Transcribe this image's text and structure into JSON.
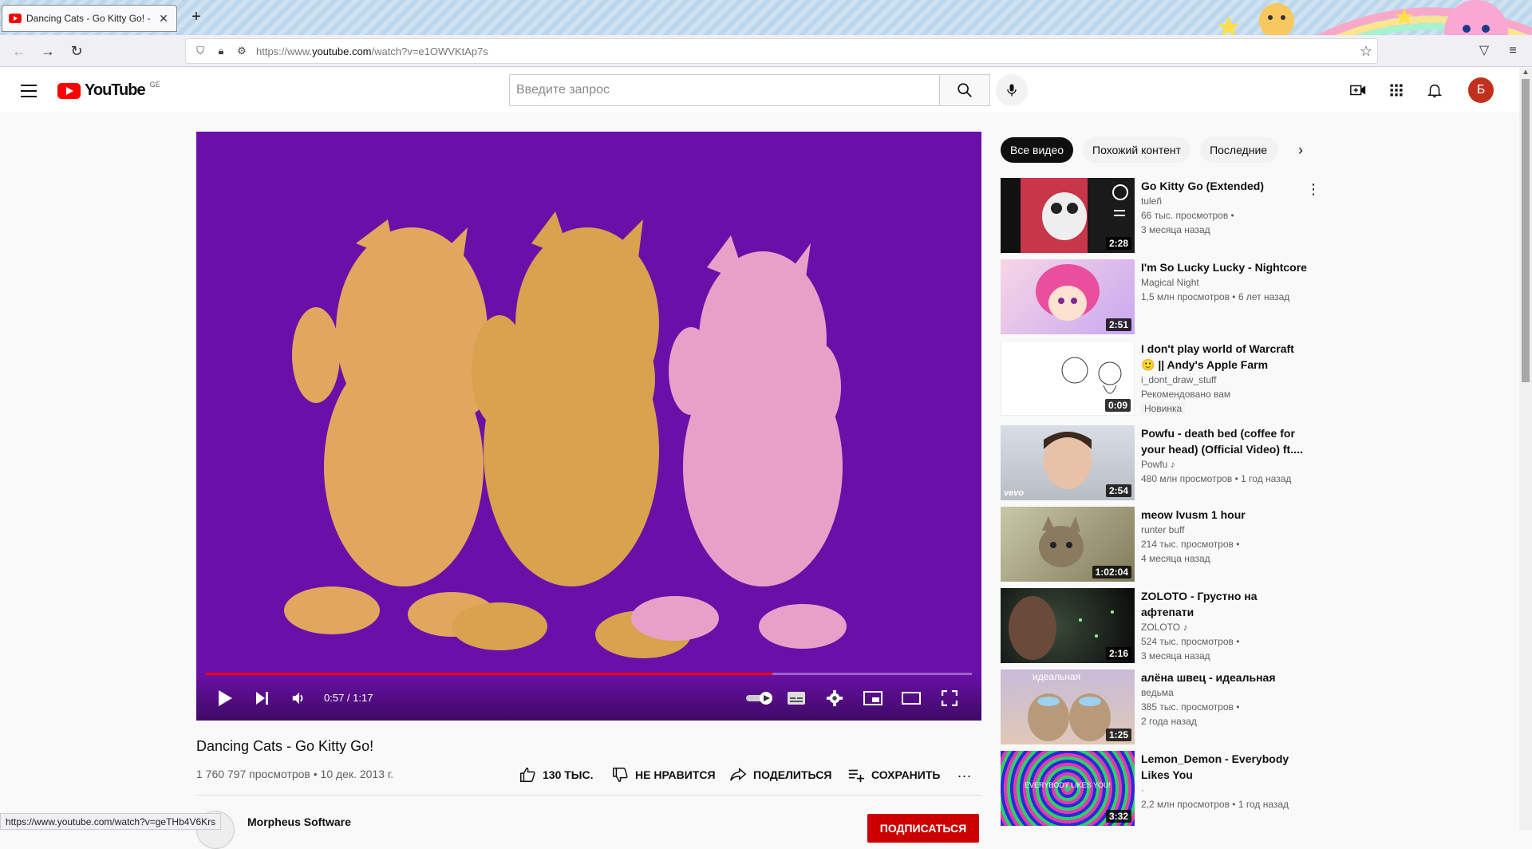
{
  "browser": {
    "tab_title": "Dancing Cats - Go Kitty Go! - YouTube",
    "new_tab": "+",
    "url_prefix": "https://www.",
    "url_domain": "youtube.com",
    "url_path": "/watch?v=e1OWVKtAp7s",
    "status_url": "https://www.youtube.com/watch?v=geTHb4V6Krs"
  },
  "header": {
    "logo": "YouTube",
    "country": "GE",
    "search_placeholder": "Введите запрос",
    "avatar_letter": "Б"
  },
  "player": {
    "time": "0:57 / 1:17",
    "progress": 0.74,
    "colors": {
      "background": "#6a10a8",
      "progress": "#ff0000"
    }
  },
  "video": {
    "title": "Dancing Cats - Go Kitty Go!",
    "meta": "1 760 797 просмотров • 10 дек. 2013 г.",
    "like": "130 ТЫС.",
    "dislike": "НЕ НРАВИТСЯ",
    "share": "ПОДЕЛИТЬСЯ",
    "save": "СОХРАНИТЬ",
    "more": "...",
    "channel": "Morpheus Software",
    "subscribe": "ПОДПИСАТЬСЯ"
  },
  "chips": [
    {
      "label": "Все видео"
    },
    {
      "label": "Похожий контент"
    },
    {
      "label": "Последние"
    }
  ],
  "recommendations": [
    {
      "title": "Go Kitty Go (Extended)",
      "channel": "tuleñ",
      "line1": "66 тыс. просмотров •",
      "line2": "3 месяца назад",
      "duration": "2:28"
    },
    {
      "title": "I'm So Lucky Lucky - Nightcore",
      "channel": "Magical Night",
      "line1": "1,5 млн просмотров • 6 лет назад",
      "line2": "",
      "duration": "2:51"
    },
    {
      "title": "I don't play world of Warcraft 🙂 || Andy's Apple Farm",
      "channel": "i_dont_draw_stuff",
      "line1": "Рекомендовано вам",
      "line2": "Новинка",
      "duration": "0:09"
    },
    {
      "title": "Powfu - death bed (coffee for your head) (Official Video) ft....",
      "channel": "Powfu ♪",
      "line1": "480 млн просмотров • 1 год назад",
      "line2": "",
      "duration": "2:54",
      "overlay": "vevo"
    },
    {
      "title": "meow lvusm 1 hour",
      "channel": "runter buff",
      "line1": "214 тыс. просмотров •",
      "line2": "4 месяца назад",
      "duration": "1:02:04"
    },
    {
      "title": "ZOLOTO - Грустно на афтепати",
      "channel": "ZOLOTO ♪",
      "line1": "524 тыс. просмотров •",
      "line2": "3 месяца назад",
      "duration": "2:16"
    },
    {
      "title": "алёна швец - идеальная",
      "channel": "ведьма",
      "line1": "385 тыс. просмотров •",
      "line2": "2 года назад",
      "duration": "1:25",
      "overlay": "идеальная"
    },
    {
      "title": "Lemon_Demon - Everybody Likes You",
      "channel": "·",
      "line1": "2,2 млн просмотров • 1 год назад",
      "line2": "",
      "duration": "3:32",
      "overlay": "EVERYBODY LIKES YOU!"
    }
  ]
}
